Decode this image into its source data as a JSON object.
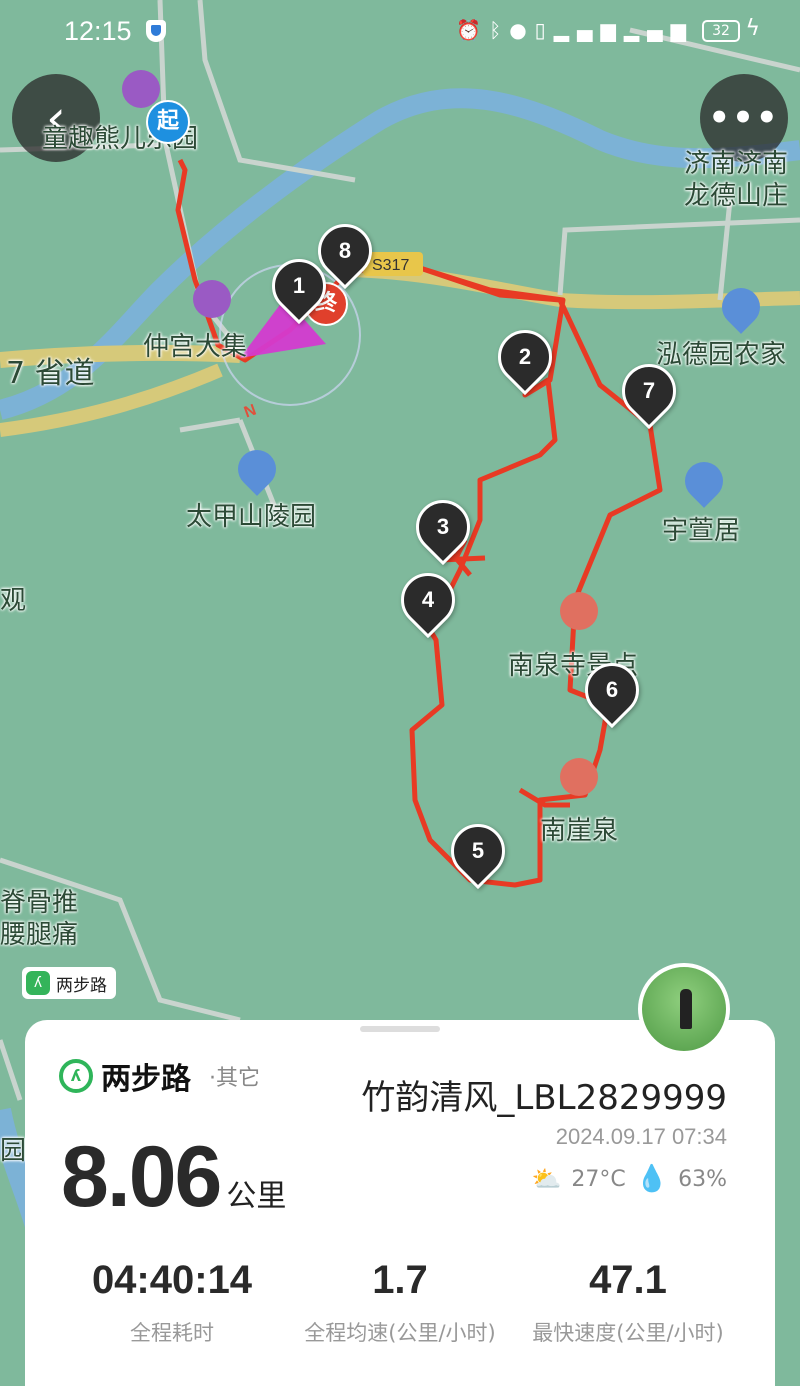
{
  "status_bar": {
    "time": "12:15",
    "icons": [
      "alarm-icon",
      "bluetooth-icon",
      "location-icon",
      "vibrate-icon",
      "signal-4g-icon",
      "signal-4g-icon"
    ],
    "battery": "32"
  },
  "map": {
    "labels": {
      "park": "童趣熊儿乐园",
      "jinan": "济南济南",
      "longde": "龙德山庄",
      "road": "7 省道",
      "zhonggong": "仲宫大集",
      "hongde": "泓德园农家",
      "taijia": "太甲山陵园",
      "yuxuan": "宇萱居",
      "nanquansi": "南泉寺景点",
      "nanya": "南崖泉",
      "left_edge_1": "观",
      "left_edge_2": "脊骨推",
      "left_edge_3": "腰腿痛",
      "left_edge_4": "园",
      "route_number": "S317",
      "north": "N"
    },
    "start_label": "起",
    "end_label": "终",
    "waypoints": [
      "1",
      "2",
      "3",
      "4",
      "5",
      "6",
      "7",
      "8"
    ],
    "brand_mini": "两步路"
  },
  "summary": {
    "brand": "两步路",
    "category": "·其它",
    "user": "竹韵清风_LBL2829999",
    "datetime": "2024.09.17 07:34",
    "temperature": "27°C",
    "humidity": "63%",
    "distance": "8.06",
    "distance_unit": "公里",
    "stats": [
      {
        "value": "04:40:14",
        "label": "全程耗时"
      },
      {
        "value": "1.7",
        "label": "全程均速(公里/小时)"
      },
      {
        "value": "47.1",
        "label": "最快速度(公里/小时)"
      }
    ]
  }
}
